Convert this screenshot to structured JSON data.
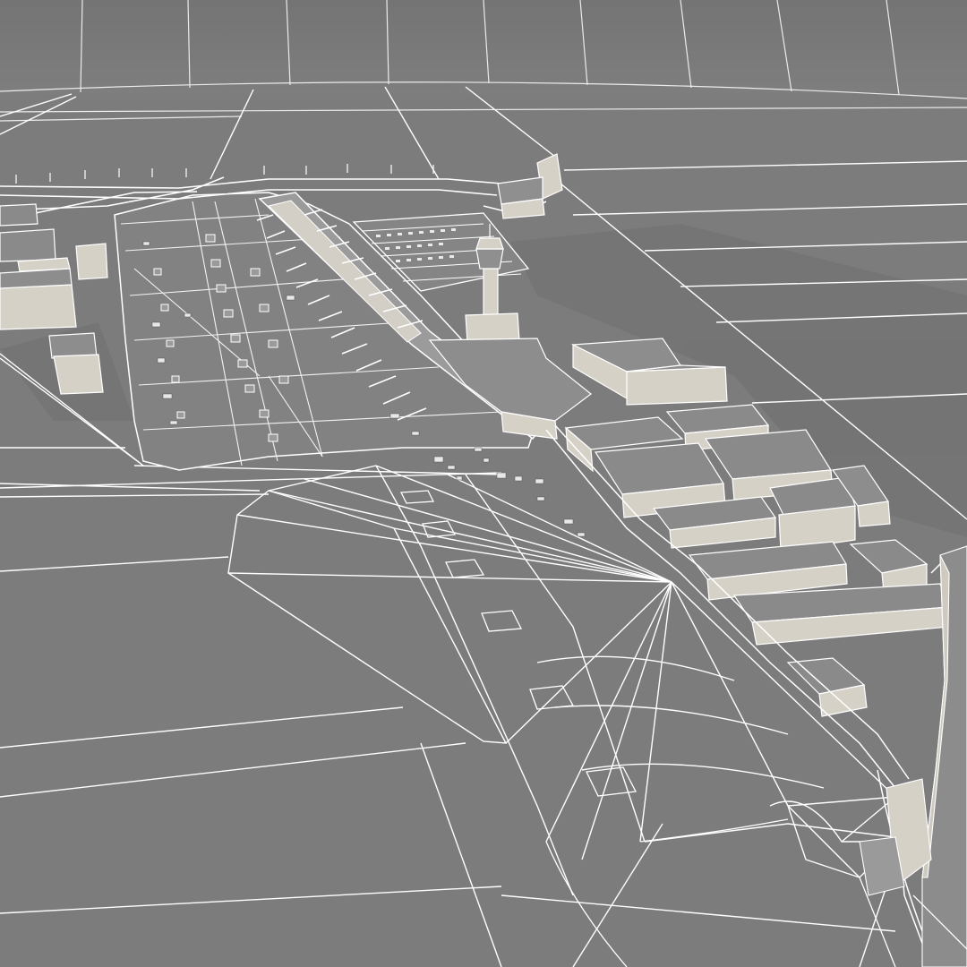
{
  "scene": {
    "subject": "",
    "render_style": "wireframe",
    "colors": {
      "ground": "#7c7c7c",
      "ground_light": "#858585",
      "wire": "#ffffff",
      "building_top": "#8a8a8a",
      "building_side": "#d6d1c7",
      "building_dark": "#5f5f5f",
      "shadow": "#6b6b6b"
    }
  }
}
